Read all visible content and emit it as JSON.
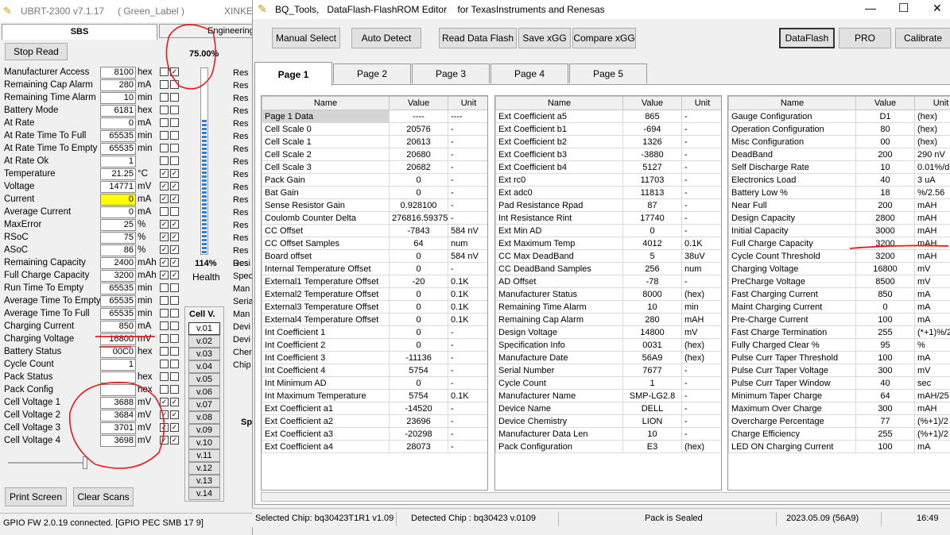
{
  "bg_window": {
    "title": "UBRT-2300 v7.1.17",
    "label": "( Green_Label )",
    "title_cut": "XINKE",
    "tab_sbs": "SBS",
    "tab_eng": "Engineering",
    "stop_read": "Stop Read",
    "percent": "75.00%",
    "health_pct": "114%",
    "health_label": "Health",
    "cell_v_title": "Cell V.",
    "print_screen": "Print Screen",
    "clear_scans": "Clear Scans",
    "fw_status": "GPIO FW 2.0.19 connected. [GPIO  PEC  SMB  17 9]",
    "rows": [
      {
        "label": "Manufacturer Access",
        "value": "8100",
        "unit": "hex",
        "c1": false,
        "c2": true
      },
      {
        "label": "Remaining Cap Alarm",
        "value": "280",
        "unit": "mA",
        "c1": false,
        "c2": false
      },
      {
        "label": "Remaining Time Alarm",
        "value": "10",
        "unit": "min",
        "c1": false,
        "c2": false
      },
      {
        "label": "Battery Mode",
        "value": "6181",
        "unit": "hex",
        "c1": false,
        "c2": false
      },
      {
        "label": "At Rate",
        "value": "0",
        "unit": "mA",
        "c1": false,
        "c2": false
      },
      {
        "label": "At Rate Time To Full",
        "value": "65535",
        "unit": "min",
        "c1": false,
        "c2": false
      },
      {
        "label": "At Rate Time To Empty",
        "value": "65535",
        "unit": "min",
        "c1": false,
        "c2": false
      },
      {
        "label": "At Rate Ok",
        "value": "1",
        "unit": "",
        "c1": false,
        "c2": false
      },
      {
        "label": "Temperature",
        "value": "21.25",
        "unit": "°C",
        "c1": true,
        "c2": true
      },
      {
        "label": "Voltage",
        "value": "14771",
        "unit": "mV",
        "c1": true,
        "c2": true
      },
      {
        "label": "Current",
        "value": "0",
        "unit": "mA",
        "c1": true,
        "c2": true,
        "hl": true
      },
      {
        "label": "Average Current",
        "value": "0",
        "unit": "mA",
        "c1": false,
        "c2": false
      },
      {
        "label": "MaxError",
        "value": "25",
        "unit": "%",
        "c1": true,
        "c2": true
      },
      {
        "label": "RSoC",
        "value": "75",
        "unit": "%",
        "c1": true,
        "c2": true
      },
      {
        "label": "ASoC",
        "value": "86",
        "unit": "%",
        "c1": true,
        "c2": true
      },
      {
        "label": "Remaining Capacity",
        "value": "2400",
        "unit": "mAh",
        "c1": true,
        "c2": true
      },
      {
        "label": "Full Charge Capacity",
        "value": "3200",
        "unit": "mAh",
        "c1": true,
        "c2": true
      },
      {
        "label": "Run Time To Empty",
        "value": "65535",
        "unit": "min",
        "c1": false,
        "c2": false
      },
      {
        "label": "Average Time To Empty",
        "value": "65535",
        "unit": "min",
        "c1": false,
        "c2": false
      },
      {
        "label": "Average Time To Full",
        "value": "65535",
        "unit": "min",
        "c1": false,
        "c2": false
      },
      {
        "label": "Charging Current",
        "value": "850",
        "unit": "mA",
        "c1": false,
        "c2": false
      },
      {
        "label": "Charging Voltage",
        "value": "16800",
        "unit": "mV",
        "c1": false,
        "c2": false
      },
      {
        "label": "Battery Status",
        "value": "00C0",
        "unit": "hex",
        "c1": false,
        "c2": false
      },
      {
        "label": "Cycle Count",
        "value": "1",
        "unit": "",
        "c1": false,
        "c2": false
      },
      {
        "label": "Pack Status",
        "value": "",
        "unit": "hex",
        "c1": false,
        "c2": false
      },
      {
        "label": "Pack Config",
        "value": "",
        "unit": "hex",
        "c1": false,
        "c2": false
      },
      {
        "label": "Cell Voltage 1",
        "value": "3688",
        "unit": "mV",
        "c1": true,
        "c2": true
      },
      {
        "label": "Cell Voltage 2",
        "value": "3684",
        "unit": "mV",
        "c1": true,
        "c2": true
      },
      {
        "label": "Cell Voltage 3",
        "value": "3701",
        "unit": "mV",
        "c1": true,
        "c2": true
      },
      {
        "label": "Cell Voltage 4",
        "value": "3698",
        "unit": "mV",
        "c1": true,
        "c2": true
      }
    ],
    "cellv": [
      "v.01",
      "v.02",
      "v.03",
      "v.04",
      "v.05",
      "v.06",
      "v.07",
      "v.08",
      "v.09",
      "v.10",
      "v.11",
      "v.12",
      "v.13",
      "v.14"
    ],
    "right_cut": [
      "Res",
      "Res",
      "Res",
      "Res",
      "Res",
      "Res",
      "Res",
      "Res",
      "Res",
      "Res",
      "Res",
      "Res",
      "Res",
      "Res",
      "Res",
      "Res",
      "Desi",
      "Spec",
      "Man",
      "Seria",
      "Man",
      "Devi",
      "Devi",
      "Chen",
      "Chip"
    ],
    "sp_cut": "Sp"
  },
  "editor": {
    "title": "BQ_Tools,   DataFlash-FlashROM Editor    for TexasInstruments and Renesas",
    "min": "—",
    "max": "☐",
    "close": "✕",
    "buttons": [
      "Manual Select",
      "Auto Detect",
      "Read Data Flash",
      "Save xGG",
      "Compare xGG"
    ],
    "modes": [
      "DataFlash",
      "PRO",
      "Calibrate"
    ],
    "tabs": [
      "Page 1",
      "Page 2",
      "Page 3",
      "Page 4",
      "Page 5"
    ],
    "col_headers": [
      "Name",
      "Value",
      "Unit"
    ],
    "table1": [
      [
        "Page 1 Data",
        "----",
        "----"
      ],
      [
        "Cell Scale 0",
        "20576",
        "-"
      ],
      [
        "Cell Scale 1",
        "20613",
        "-"
      ],
      [
        "Cell Scale 2",
        "20680",
        "-"
      ],
      [
        "Cell Scale 3",
        "20682",
        "-"
      ],
      [
        "Pack Gain",
        "0",
        "-"
      ],
      [
        "Bat Gain",
        "0",
        "-"
      ],
      [
        "Sense Resistor Gain",
        "0.928100",
        "-"
      ],
      [
        "Coulomb Counter Delta",
        "276816.593750",
        "-"
      ],
      [
        "CC Offset",
        "-7843",
        "584 nV"
      ],
      [
        "CC Offset Samples",
        "64",
        "num"
      ],
      [
        "Board offset",
        "0",
        "584 nV"
      ],
      [
        "Internal Temperature Offset",
        "0",
        "-"
      ],
      [
        "External1 Temperature Offset",
        "-20",
        "0.1K"
      ],
      [
        "External2 Temperature Offset",
        "0",
        "0.1K"
      ],
      [
        "External3 Temperature Offset",
        "0",
        "0.1K"
      ],
      [
        "External4 Temperature Offset",
        "0",
        "0.1K"
      ],
      [
        "Int Coefficient 1",
        "0",
        "-"
      ],
      [
        "Int Coefficient 2",
        "0",
        "-"
      ],
      [
        "Int Coefficient 3",
        "-11136",
        "-"
      ],
      [
        "Int Coefficient 4",
        "5754",
        "-"
      ],
      [
        "Int Minimum AD",
        "0",
        "-"
      ],
      [
        "Int Maximum Temperature",
        "5754",
        "0.1K"
      ],
      [
        "Ext Coefficient a1",
        "-14520",
        "-"
      ],
      [
        "Ext Coefficient a2",
        "23696",
        "-"
      ],
      [
        "Ext Coefficient a3",
        "-20298",
        "-"
      ],
      [
        "Ext Coefficient a4",
        "28073",
        "-"
      ]
    ],
    "table2": [
      [
        "Ext Coefficient a5",
        "865",
        "-"
      ],
      [
        "Ext Coefficient b1",
        "-694",
        "-"
      ],
      [
        "Ext Coefficient b2",
        "1326",
        "-"
      ],
      [
        "Ext Coefficient b3",
        "-3880",
        "-"
      ],
      [
        "Ext Coefficient b4",
        "5127",
        "-"
      ],
      [
        "Ext rc0",
        "11703",
        "-"
      ],
      [
        "Ext adc0",
        "11813",
        "-"
      ],
      [
        "Pad Resistance Rpad",
        "87",
        "-"
      ],
      [
        "Int Resistance Rint",
        "17740",
        "-"
      ],
      [
        "Ext Min AD",
        "0",
        "-"
      ],
      [
        "Ext Maximum Temp",
        "4012",
        "0.1K"
      ],
      [
        "CC Max DeadBand",
        "5",
        "38uV"
      ],
      [
        "CC DeadBand Samples",
        "256",
        "num"
      ],
      [
        "AD Offset",
        "-78",
        "-"
      ],
      [
        "Manufacturer Status",
        "8000",
        "(hex)"
      ],
      [
        "Remaining Time Alarm",
        "10",
        "min"
      ],
      [
        "Remaining Cap Alarm",
        "280",
        "mAH"
      ],
      [
        "Design Voltage",
        "14800",
        "mV"
      ],
      [
        "Specification Info",
        "0031",
        "(hex)"
      ],
      [
        "Manufacture Date",
        "56A9",
        "(hex)"
      ],
      [
        "Serial Number",
        "7677",
        "-"
      ],
      [
        "Cycle Count",
        "1",
        "-"
      ],
      [
        "Manufacturer Name",
        "SMP-LG2.8",
        "-"
      ],
      [
        "Device Name",
        "DELL",
        "-"
      ],
      [
        "Device Chemistry",
        "LION",
        "-"
      ],
      [
        "Manufacturer Data Len",
        "10",
        "-"
      ],
      [
        "Pack Configuration",
        "E3",
        "(hex)"
      ]
    ],
    "table3": [
      [
        "Gauge Configuration",
        "D1",
        "(hex)"
      ],
      [
        "Operation Configuration",
        "80",
        "(hex)"
      ],
      [
        "Misc Configuration",
        "00",
        "(hex)"
      ],
      [
        "DeadBand",
        "200",
        "290 nV"
      ],
      [
        "Self Discharge Rate",
        "10",
        "0.01%/d"
      ],
      [
        "Electronics Load",
        "40",
        "3 uA"
      ],
      [
        "Battery Low %",
        "18",
        "%/2.56"
      ],
      [
        "Near Full",
        "200",
        "mAH"
      ],
      [
        "Design Capacity",
        "2800",
        "mAH"
      ],
      [
        "Initial Capacity",
        "3000",
        "mAH"
      ],
      [
        "Full Charge Capacity",
        "3200",
        "mAH"
      ],
      [
        "Cycle Count Threshold",
        "3200",
        "mAH"
      ],
      [
        "Charging Voltage",
        "16800",
        "mV"
      ],
      [
        "PreCharge Voltage",
        "8500",
        "mV"
      ],
      [
        "Fast Charging Current",
        "850",
        "mA"
      ],
      [
        "Maint Charging Current",
        "0",
        "mA"
      ],
      [
        "Pre-Charge Current",
        "100",
        "mA"
      ],
      [
        "Fast Charge Termination",
        "255",
        "(*+1)%/2"
      ],
      [
        "Fully Charged Clear %",
        "95",
        "%"
      ],
      [
        "Pulse Curr Taper Threshold",
        "100",
        "mA"
      ],
      [
        "Pulse Curr Taper Voltage",
        "300",
        "mV"
      ],
      [
        "Pulse Curr Taper Window",
        "40",
        "sec"
      ],
      [
        "Minimum Taper Charge",
        "64",
        "mAH/25"
      ],
      [
        "Maximum Over Charge",
        "300",
        "mAH"
      ],
      [
        "Overcharge Percentage",
        "77",
        "(%+1)/2"
      ],
      [
        "Charge Efficiency",
        "255",
        "(%+1)/2"
      ],
      [
        "LED ON Charging Current",
        "100",
        "mA"
      ]
    ],
    "status": {
      "selected": "Selected Chip:  bq30423T1R1 v1.09",
      "detected": "Detected Chip : bq30423  v.0109",
      "sealed": "Pack is Sealed",
      "date": "2023.05.09  (56A9)",
      "time": "16:49"
    }
  }
}
